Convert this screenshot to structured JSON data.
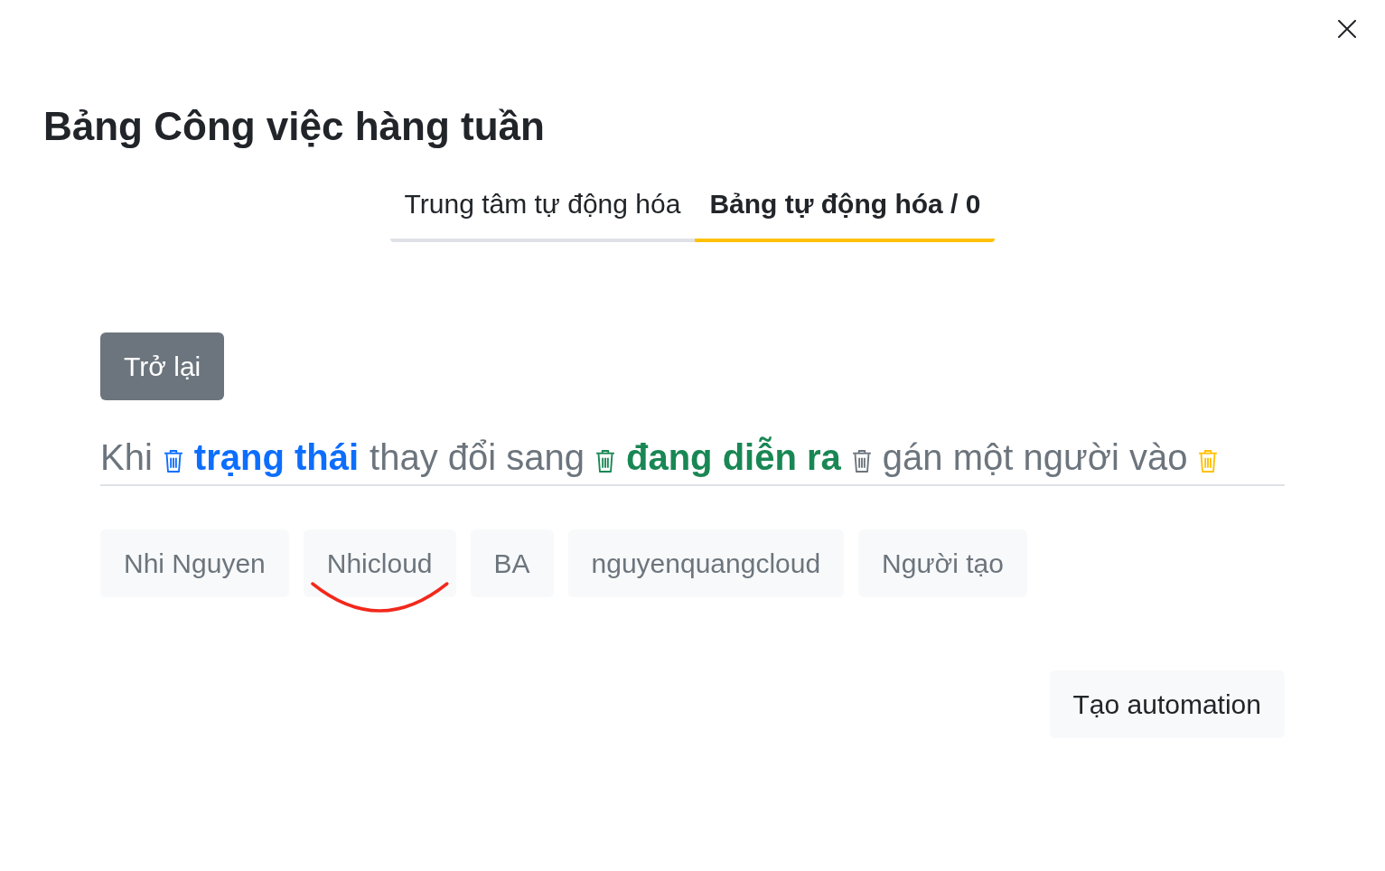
{
  "title": "Bảng Công việc hàng tuần",
  "tabs": [
    {
      "label": "Trung tâm tự động hóa",
      "selected": false
    },
    {
      "label": "Bảng tự động hóa / 0",
      "selected": true
    }
  ],
  "back_button": "Trở lại",
  "rule": {
    "parts": [
      {
        "kind": "text",
        "text": "Khi"
      },
      {
        "kind": "trash",
        "color": "#0d6efd"
      },
      {
        "kind": "field",
        "text": "trạng thái",
        "color": "#0d6efd"
      },
      {
        "kind": "text",
        "text": "thay đổi sang"
      },
      {
        "kind": "trash",
        "color": "#198754"
      },
      {
        "kind": "field",
        "text": "đang diễn ra",
        "color": "#198754"
      },
      {
        "kind": "trash",
        "color": "#6c757d"
      },
      {
        "kind": "text",
        "text": "gán một người vào"
      },
      {
        "kind": "trash",
        "color": "#ffc107"
      }
    ]
  },
  "assignees": [
    {
      "name": "Nhi Nguyen",
      "marked": false
    },
    {
      "name": "Nhicloud",
      "marked": true
    },
    {
      "name": "BA",
      "marked": false
    },
    {
      "name": "nguyenquangcloud",
      "marked": false
    },
    {
      "name": "Người tạo",
      "marked": false
    }
  ],
  "create_button": "Tạo automation"
}
